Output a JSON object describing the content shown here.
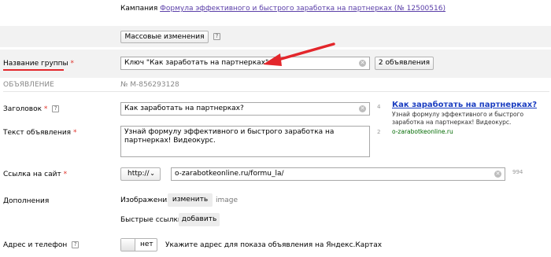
{
  "campaign": {
    "prefix": "Кампания",
    "link": "Формула эффективного и быстрого заработка на партнерках (№ 12500516)"
  },
  "mass_changes": {
    "label": "Массовые изменения",
    "help": "?"
  },
  "group": {
    "label": "Название группы",
    "required_mark": "*",
    "value": "Ключ \"Как заработать на партнерках\"",
    "ads_button": "2 объявления"
  },
  "ad_section": {
    "heading": "ОБЪЯВЛЕНИЕ",
    "number": "№ M-856293128"
  },
  "title_field": {
    "label": "Заголовок",
    "required_mark": "*",
    "help": "?",
    "value": "Как заработать на партнерках?",
    "counter": "4"
  },
  "text_field": {
    "label": "Текст объявления",
    "required_mark": "*",
    "value": "Узнай формулу эффективного и быстрого заработка на партнерках! Видеокурс.",
    "counter": "2"
  },
  "url_field": {
    "label": "Ссылка на сайт",
    "required_mark": "*",
    "protocol": "http://",
    "value": "o-zarabotkeonline.ru/formu_la/",
    "counter": "994"
  },
  "preview": {
    "title": "Как заработать на партнерках?",
    "text": "Узнай формулу эффективного и быстрого заработка на партнерках! Видеокурс.",
    "domain": "o-zarabotkeonline.ru"
  },
  "extras": {
    "label": "Дополнения",
    "images_label": "Изображения",
    "images_button": "изменить",
    "images_value": "image",
    "sitelinks_label": "Быстрые ссылки",
    "sitelinks_button": "добавить"
  },
  "address": {
    "label": "Адрес и телефон",
    "help": "?",
    "toggle": "нет",
    "hint": "Укажите адрес для показа объявления на Яндекс.Картах"
  },
  "colors": {
    "arrow": "#e3262b",
    "link": "#5a3ea8",
    "preview_title": "#1a3dc1",
    "domain": "#006a00"
  }
}
